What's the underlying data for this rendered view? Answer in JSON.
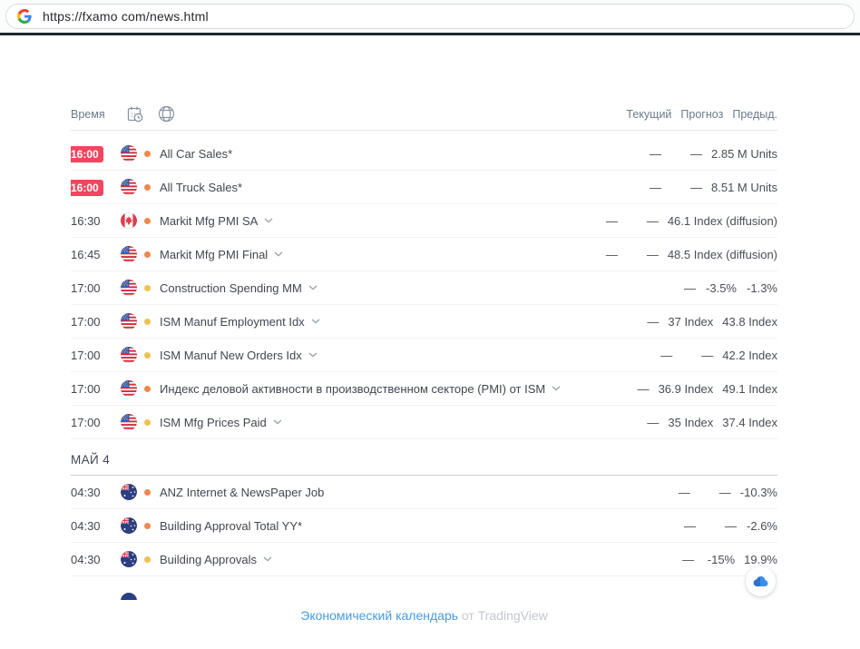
{
  "browser": {
    "url": "https://fxamo com/news.html",
    "favicon": "google-g-icon"
  },
  "calendar": {
    "header": {
      "time_label": "Время",
      "columns": [
        "Текущий",
        "Прогноз",
        "Предыд."
      ]
    },
    "groups": [
      {
        "label": "",
        "rows": [
          {
            "time": "16:00",
            "highlight": true,
            "flag": "us",
            "importance": "orange",
            "event": "All Car Sales*",
            "expandable": false,
            "actual": "—",
            "forecast": "—",
            "previous": "2.85 M Units"
          },
          {
            "time": "16:00",
            "highlight": true,
            "flag": "us",
            "importance": "orange",
            "event": "All Truck Sales*",
            "expandable": false,
            "actual": "—",
            "forecast": "—",
            "previous": "8.51 M Units"
          },
          {
            "time": "16:30",
            "highlight": false,
            "flag": "ca",
            "importance": "orange",
            "event": "Markit Mfg PMI SA",
            "expandable": true,
            "actual": "—",
            "forecast": "—",
            "previous": "46.1 Index (diffusion)"
          },
          {
            "time": "16:45",
            "highlight": false,
            "flag": "us",
            "importance": "orange",
            "event": "Markit Mfg PMI Final",
            "expandable": true,
            "actual": "—",
            "forecast": "—",
            "previous": "48.5 Index (diffusion)"
          },
          {
            "time": "17:00",
            "highlight": false,
            "flag": "us",
            "importance": "yellow",
            "event": "Construction Spending MM",
            "expandable": true,
            "actual": "—",
            "forecast": "-3.5%",
            "previous": "-1.3%"
          },
          {
            "time": "17:00",
            "highlight": false,
            "flag": "us",
            "importance": "yellow",
            "event": "ISM Manuf Employment Idx",
            "expandable": true,
            "actual": "—",
            "forecast": "37 Index",
            "previous": "43.8 Index"
          },
          {
            "time": "17:00",
            "highlight": false,
            "flag": "us",
            "importance": "yellow",
            "event": "ISM Manuf New Orders Idx",
            "expandable": true,
            "actual": "—",
            "forecast": "—",
            "previous": "42.2 Index"
          },
          {
            "time": "17:00",
            "highlight": false,
            "flag": "us",
            "importance": "orange",
            "event": "Индекс деловой активности в производственном секторе (PMI) от ISM",
            "expandable": true,
            "actual": "—",
            "forecast": "36.9 Index",
            "previous": "49.1 Index"
          },
          {
            "time": "17:00",
            "highlight": false,
            "flag": "us",
            "importance": "yellow",
            "event": "ISM Mfg Prices Paid",
            "expandable": true,
            "actual": "—",
            "forecast": "35 Index",
            "previous": "37.4 Index"
          }
        ]
      },
      {
        "label": "МАЙ 4",
        "rows": [
          {
            "time": "04:30",
            "highlight": false,
            "flag": "au",
            "importance": "orange",
            "event": "ANZ Internet & NewsPaper Job",
            "expandable": false,
            "actual": "—",
            "forecast": "—",
            "previous": "-10.3%"
          },
          {
            "time": "04:30",
            "highlight": false,
            "flag": "au",
            "importance": "orange",
            "event": "Building Approval Total YY*",
            "expandable": false,
            "actual": "—",
            "forecast": "—",
            "previous": "-2.6%"
          },
          {
            "time": "04:30",
            "highlight": false,
            "flag": "au",
            "importance": "yellow",
            "event": "Building Approvals",
            "expandable": true,
            "actual": "—",
            "forecast": "-15%",
            "previous": "19.9%"
          }
        ]
      }
    ],
    "footer": {
      "link": "Экономический календарь",
      "suffix": "от TradingView"
    }
  },
  "colors": {
    "badge": "#f2455f",
    "importance": {
      "orange": "#f0874c",
      "yellow": "#edc24e"
    },
    "link": "#459be0"
  }
}
